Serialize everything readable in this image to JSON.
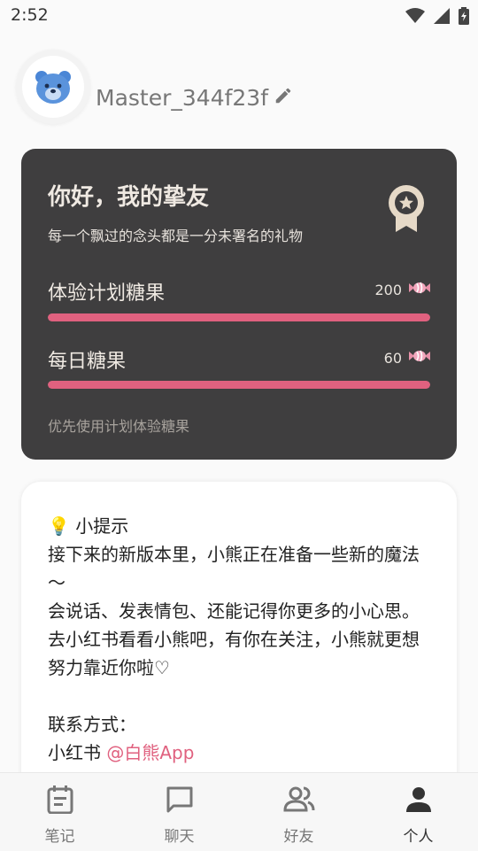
{
  "status_bar": {
    "time": "2:52",
    "icons": [
      "wifi-icon",
      "signal-icon",
      "battery-icon"
    ]
  },
  "profile": {
    "username": "Master_344f23f",
    "avatar": "bear-avatar",
    "edit_icon": "pencil-icon"
  },
  "candy_card": {
    "title": "你好，我的挚友",
    "subtitle": "每一个飘过的念头都是一分未署名的礼物",
    "badge_icon": "award-icon",
    "rows": [
      {
        "label": "体验计划糖果",
        "value": "200",
        "icon": "candy-icon",
        "progress": 1.0
      },
      {
        "label": "每日糖果",
        "value": "60",
        "icon": "candy-icon",
        "progress": 1.0
      }
    ],
    "footer": "优先使用计划体验糖果",
    "colors": {
      "background": "#3f3e3f",
      "bar": "#e0617f"
    }
  },
  "tips": {
    "heading": "💡 小提示",
    "lines": [
      "接下来的新版本里，小熊正在准备一些新的魔法～",
      "会说话、发表情包、还能记得你更多的小心思。",
      "去小红书看看小熊吧，有你在关注，小熊就更想努力靠近你啦♡"
    ],
    "contact_label": "联系方式：",
    "contact_platform": "小红书",
    "contact_handle": "@白熊App"
  },
  "bottom_nav": {
    "items": [
      {
        "label": "笔记",
        "icon": "notes-icon",
        "active": false
      },
      {
        "label": "聊天",
        "icon": "chat-icon",
        "active": false
      },
      {
        "label": "好友",
        "icon": "friends-icon",
        "active": false
      },
      {
        "label": "个人",
        "icon": "person-icon",
        "active": true
      }
    ]
  }
}
